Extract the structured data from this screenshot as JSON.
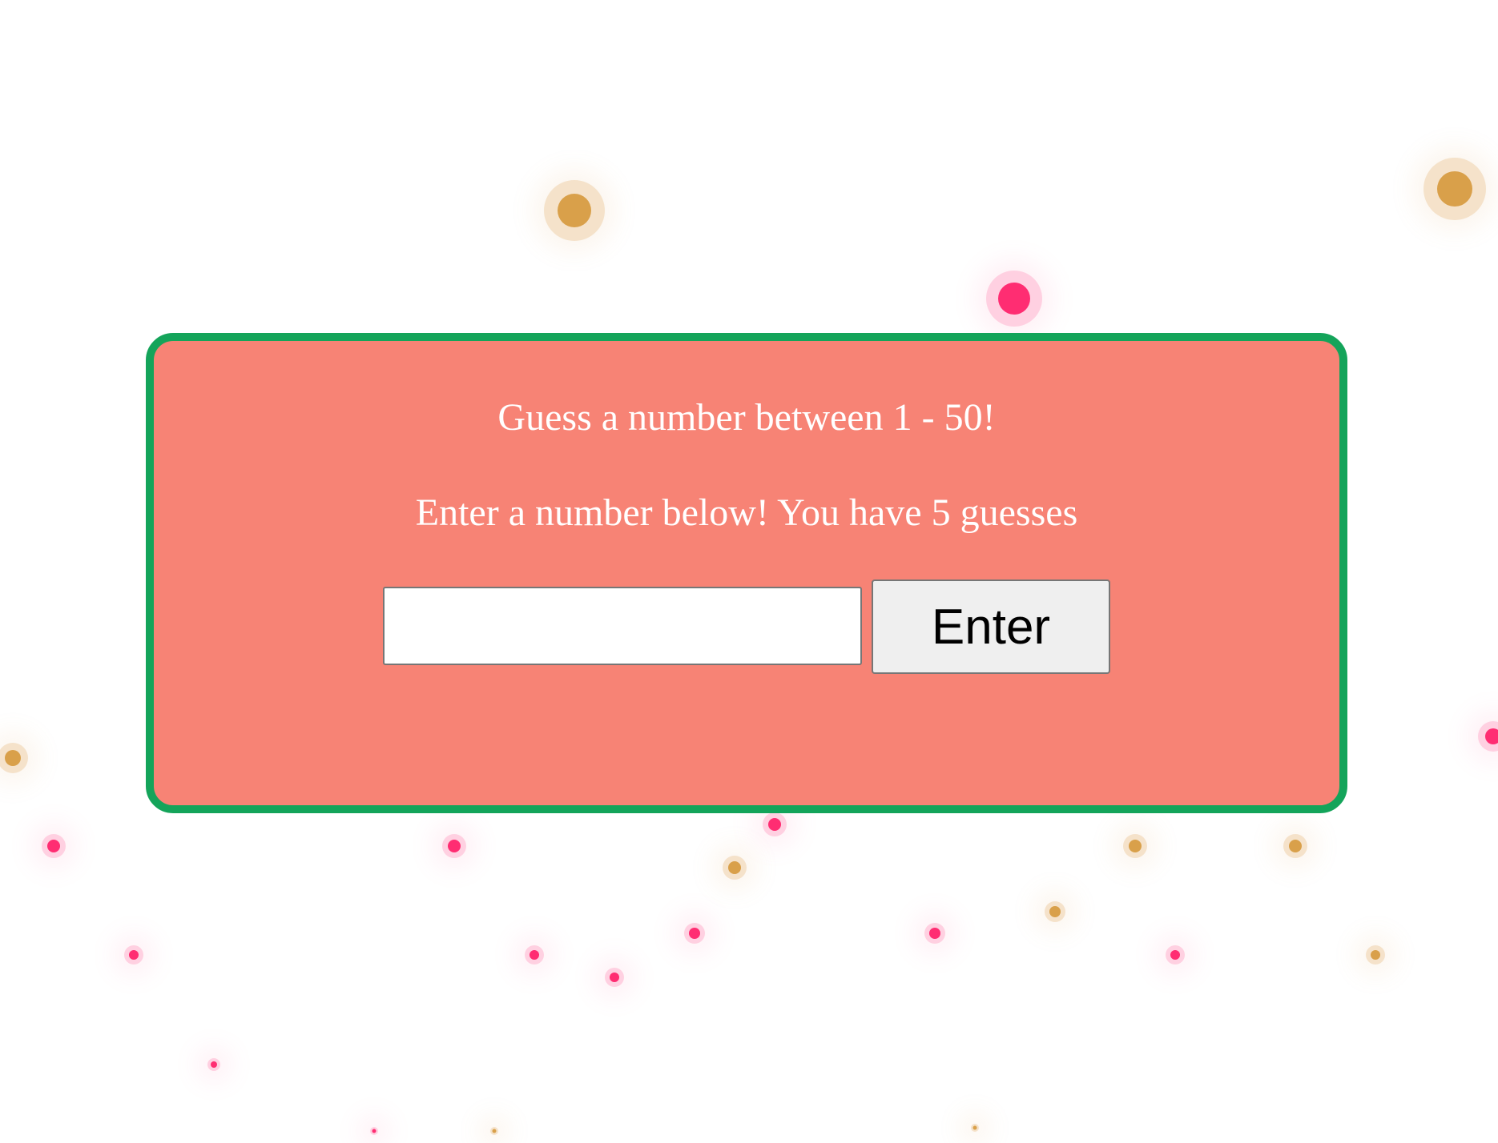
{
  "game": {
    "title": "Guess a number between 1 - 50!",
    "instructions": "Enter a number below! You have 5 guesses",
    "guess_input": {
      "value": "",
      "placeholder": ""
    },
    "enter_label": "Enter"
  },
  "colors": {
    "card_background": "#f78375",
    "card_border": "#14a45a",
    "text": "#ffffff",
    "particle_gold": "#d9a04a",
    "particle_pink": "#ff2d72"
  }
}
